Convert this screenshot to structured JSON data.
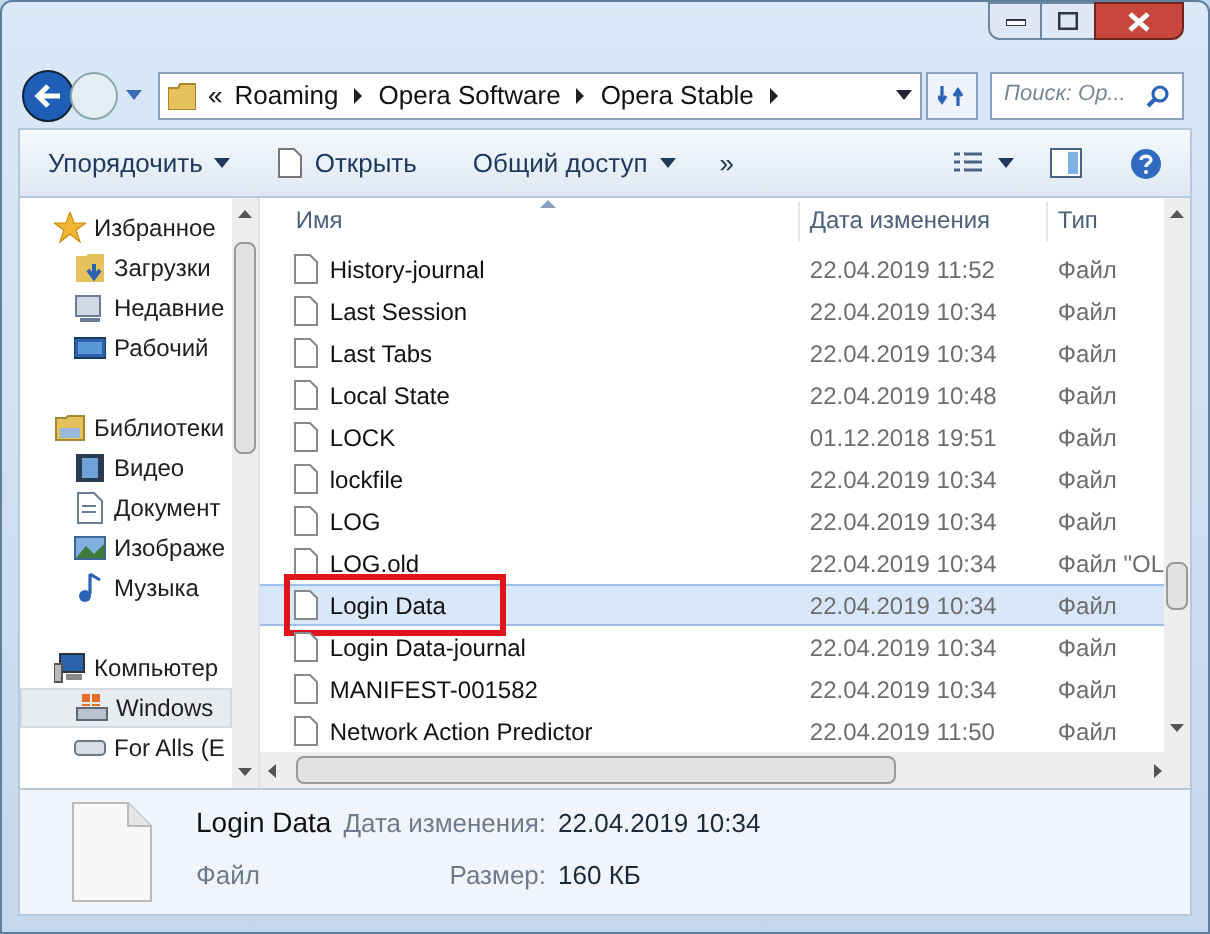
{
  "address": {
    "prefix": "«",
    "crumbs": [
      "Roaming",
      "Opera Software",
      "Opera Stable"
    ]
  },
  "search": {
    "placeholder": "Поиск: Ор..."
  },
  "toolbar": {
    "organize": "Упорядочить",
    "open": "Открыть",
    "share": "Общий доступ",
    "more": "»"
  },
  "sidebar": [
    {
      "label": "Избранное",
      "kind": "star",
      "header": true,
      "selected": false
    },
    {
      "label": "Загрузки",
      "kind": "download",
      "header": false,
      "selected": false
    },
    {
      "label": "Недавние",
      "kind": "recent",
      "header": false,
      "selected": false
    },
    {
      "label": "Рабочий",
      "kind": "desktop",
      "header": false,
      "selected": false
    },
    {
      "label": "Библиотеки",
      "kind": "library",
      "header": true,
      "selected": false
    },
    {
      "label": "Видео",
      "kind": "video",
      "header": false,
      "selected": false
    },
    {
      "label": "Документ",
      "kind": "document",
      "header": false,
      "selected": false
    },
    {
      "label": "Изображе",
      "kind": "picture",
      "header": false,
      "selected": false
    },
    {
      "label": "Музыка",
      "kind": "music",
      "header": false,
      "selected": false
    },
    {
      "label": "Компьютер",
      "kind": "computer",
      "header": true,
      "selected": false
    },
    {
      "label": "Windows",
      "kind": "drive",
      "header": false,
      "selected": true
    },
    {
      "label": "For Alls (E",
      "kind": "disk",
      "header": false,
      "selected": false
    }
  ],
  "table": {
    "columns": [
      "Имя",
      "Дата изменения",
      "Тип"
    ],
    "rows": [
      {
        "name": "History-journal",
        "date": "22.04.2019 11:52",
        "type": "Файл",
        "selected": false,
        "annotated": false
      },
      {
        "name": "Last Session",
        "date": "22.04.2019 10:34",
        "type": "Файл",
        "selected": false,
        "annotated": false
      },
      {
        "name": "Last Tabs",
        "date": "22.04.2019 10:34",
        "type": "Файл",
        "selected": false,
        "annotated": false
      },
      {
        "name": "Local State",
        "date": "22.04.2019 10:48",
        "type": "Файл",
        "selected": false,
        "annotated": false
      },
      {
        "name": "LOCK",
        "date": "01.12.2018 19:51",
        "type": "Файл",
        "selected": false,
        "annotated": false
      },
      {
        "name": "lockfile",
        "date": "22.04.2019 10:34",
        "type": "Файл",
        "selected": false,
        "annotated": false
      },
      {
        "name": "LOG",
        "date": "22.04.2019 10:34",
        "type": "Файл",
        "selected": false,
        "annotated": false
      },
      {
        "name": "LOG.old",
        "date": "22.04.2019 10:34",
        "type": "Файл \"OL",
        "selected": false,
        "annotated": false
      },
      {
        "name": "Login Data",
        "date": "22.04.2019 10:34",
        "type": "Файл",
        "selected": true,
        "annotated": true
      },
      {
        "name": "Login Data-journal",
        "date": "22.04.2019 10:34",
        "type": "Файл",
        "selected": false,
        "annotated": false
      },
      {
        "name": "MANIFEST-001582",
        "date": "22.04.2019 10:34",
        "type": "Файл",
        "selected": false,
        "annotated": false
      },
      {
        "name": "Network Action Predictor",
        "date": "22.04.2019 11:50",
        "type": "Файл",
        "selected": false,
        "annotated": false
      }
    ]
  },
  "details": {
    "name": "Login Data",
    "type": "Файл",
    "date_label": "Дата изменения:",
    "date": "22.04.2019 10:34",
    "size_label": "Размер:",
    "size": "160 КБ"
  }
}
